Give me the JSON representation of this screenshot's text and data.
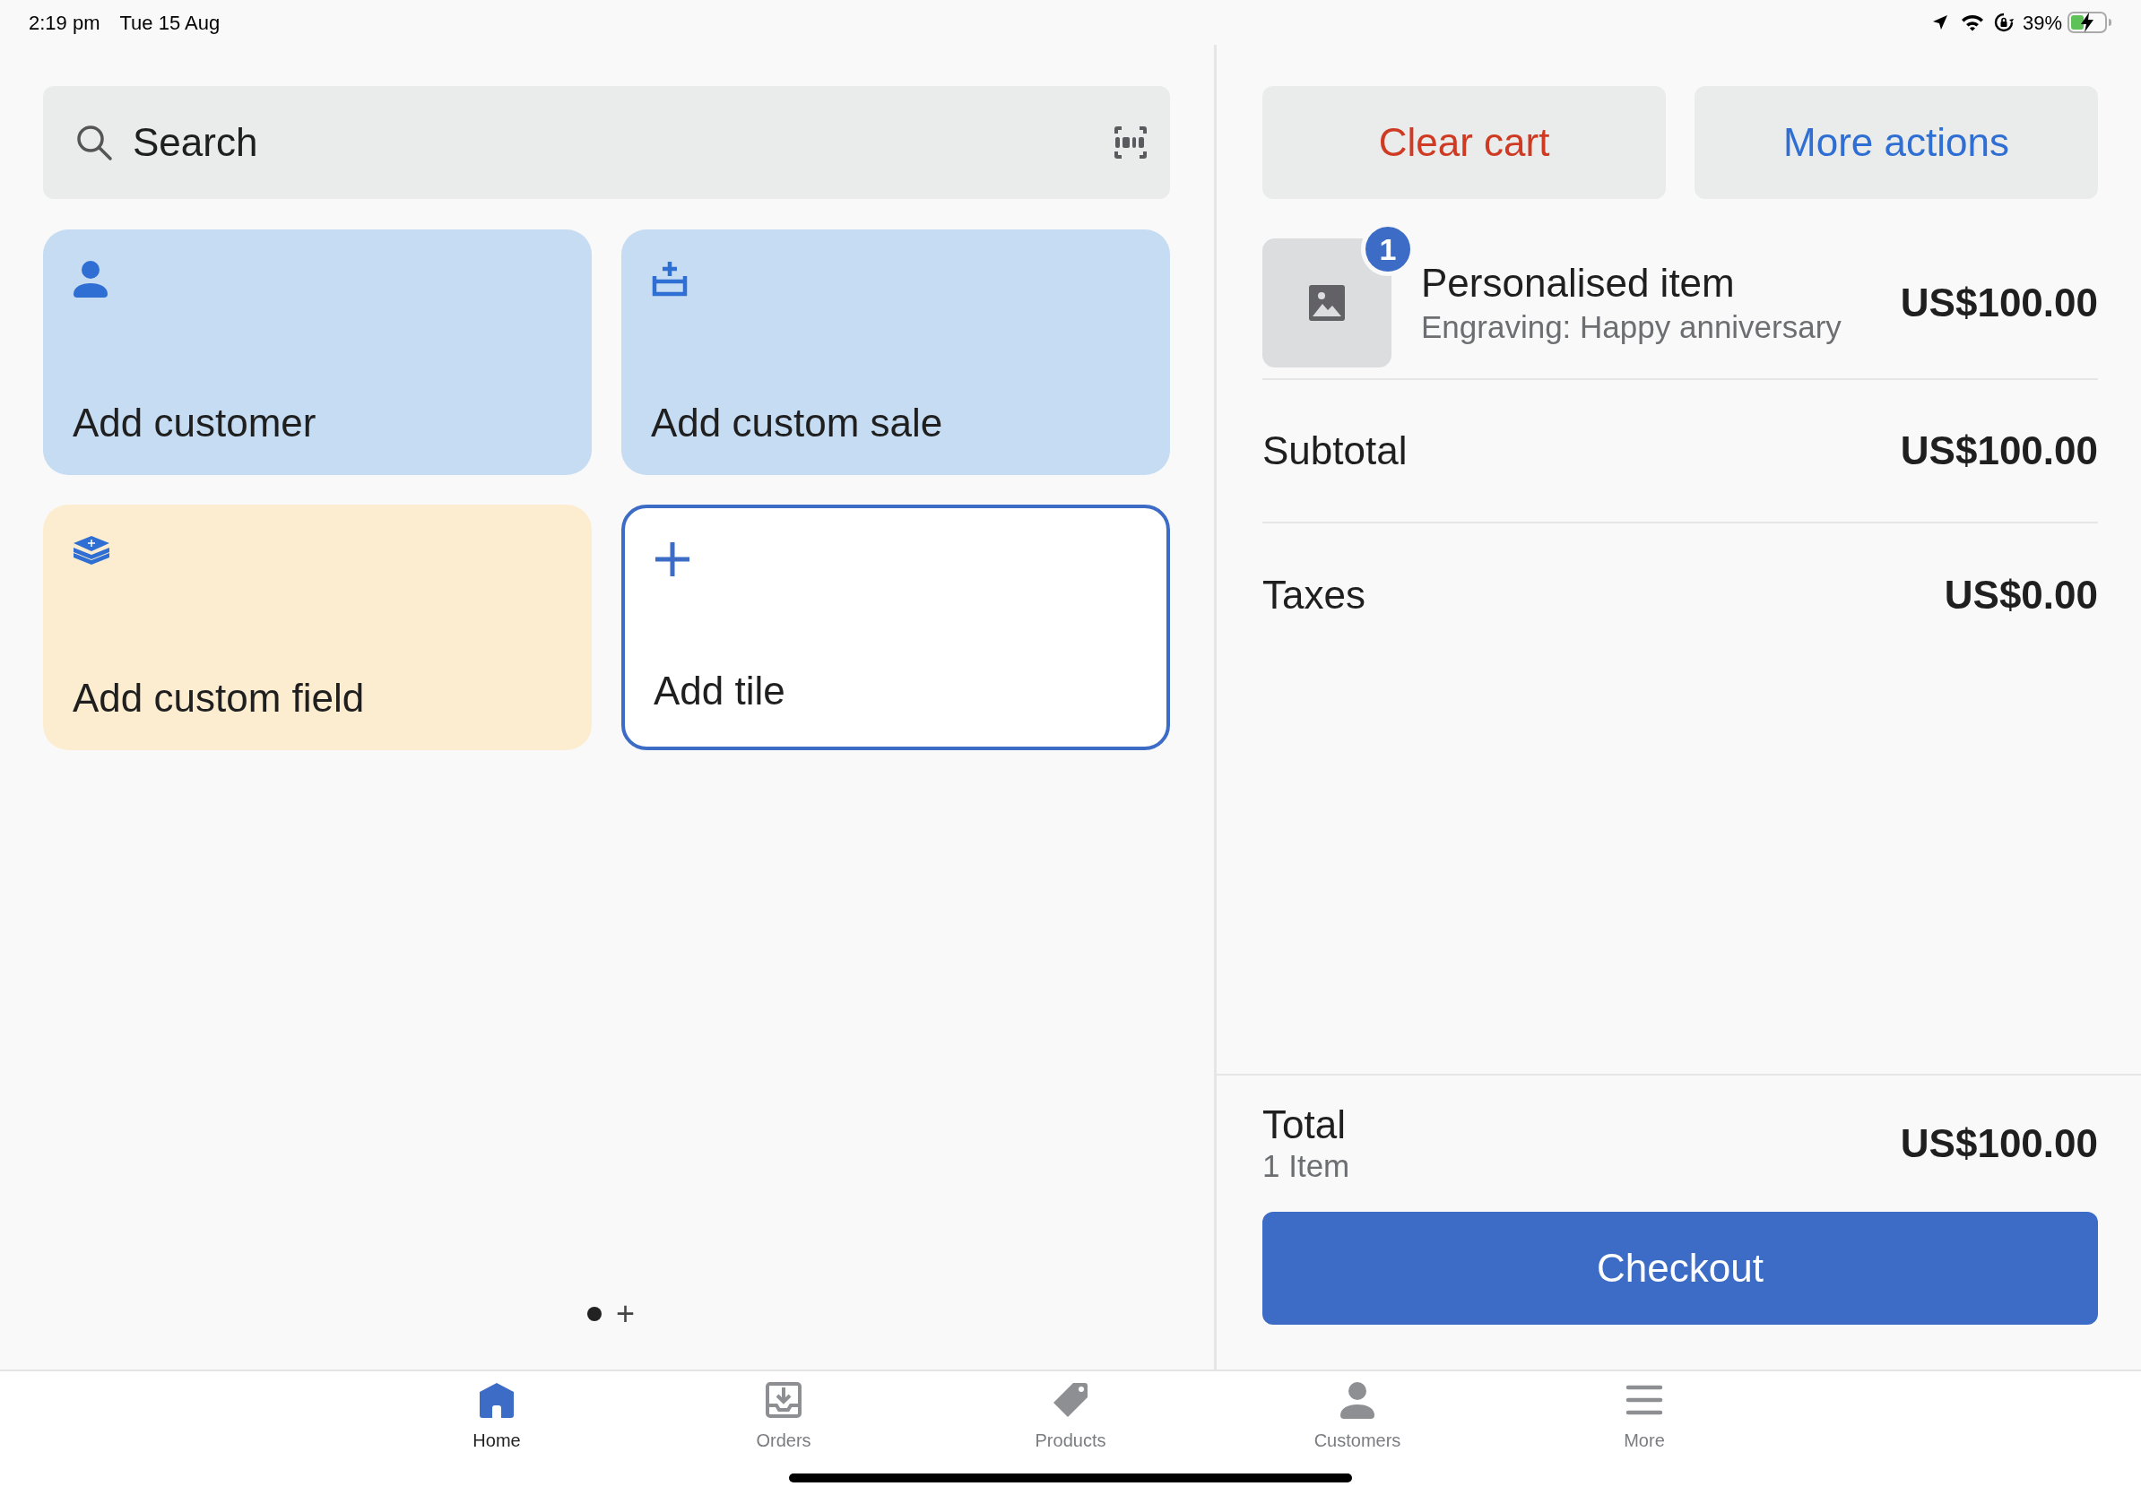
{
  "status_bar": {
    "time": "2:19 pm",
    "date": "Tue 15 Aug",
    "battery": "39%",
    "charging": true
  },
  "search": {
    "placeholder": "Search"
  },
  "tiles": [
    {
      "kind": "customer",
      "label": "Add customer",
      "color": "#c6dcf2"
    },
    {
      "kind": "custom_sale",
      "label": "Add custom sale",
      "color": "#c6dcf2"
    },
    {
      "kind": "custom_field",
      "label": "Add custom field",
      "color": "#fdedd0"
    },
    {
      "kind": "add",
      "label": "Add tile",
      "color": "#ffffff"
    }
  ],
  "pager": {
    "pages": [
      {
        "selected": true
      }
    ],
    "add": "+"
  },
  "cart_actions": [
    {
      "kind": "danger",
      "label": "Clear cart"
    },
    {
      "kind": "primary",
      "label": "More actions"
    }
  ],
  "cart_items": [
    {
      "quantity": "1",
      "name": "Personalised item",
      "note": "Engraving: Happy anniversary",
      "price": "US$100.00"
    }
  ],
  "summary": [
    {
      "label": "Subtotal",
      "amount": "US$100.00"
    },
    {
      "label": "Taxes",
      "amount": "US$0.00"
    }
  ],
  "total": {
    "label": "Total",
    "items": "1 Item",
    "amount": "US$100.00"
  },
  "checkout": {
    "label": "Checkout"
  },
  "tab_bar": [
    {
      "kind": "home",
      "label": "Home",
      "selected": true
    },
    {
      "kind": "orders",
      "label": "Orders",
      "selected": false
    },
    {
      "kind": "products",
      "label": "Products",
      "selected": false
    },
    {
      "kind": "customers",
      "label": "Customers",
      "selected": false
    },
    {
      "kind": "more",
      "label": "More",
      "selected": false
    }
  ]
}
